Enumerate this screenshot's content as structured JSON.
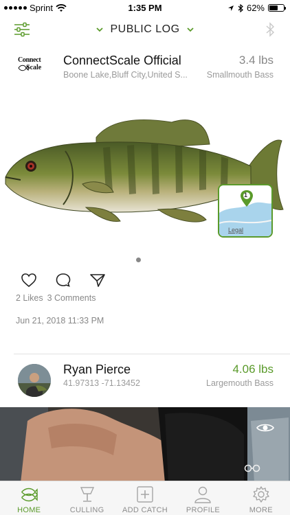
{
  "status_bar": {
    "carrier": "Sprint",
    "time": "1:35 PM",
    "battery": "62%",
    "battery_level": 0.62
  },
  "header": {
    "title": "PUBLIC LOG",
    "filter_icon": "sliders-icon",
    "bluetooth_icon": "bluetooth-icon"
  },
  "posts": [
    {
      "user": "ConnectScale Official",
      "logo_line1": "Connect",
      "logo_line2": "Scale",
      "location": "Boone Lake,Bluff City,United S...",
      "weight": "3.4 lbs",
      "species": "Smallmouth Bass",
      "map_pin": "1",
      "map_legal": "Legal",
      "likes": "2 Likes",
      "comments": "3 Comments",
      "date": "Jun 21, 2018 11:33 PM"
    },
    {
      "user": "Ryan Pierce",
      "coords": "41.97313 -71.13452",
      "weight": "4.06 lbs",
      "species": "Largemouth Bass"
    }
  ],
  "tabs": [
    {
      "label": "HOME",
      "icon": "fish-icon",
      "active": true
    },
    {
      "label": "CULLING",
      "icon": "scale-icon",
      "active": false
    },
    {
      "label": "ADD CATCH",
      "icon": "add-icon",
      "active": false
    },
    {
      "label": "PROFILE",
      "icon": "person-icon",
      "active": false
    },
    {
      "label": "MORE",
      "icon": "gear-icon",
      "active": false
    }
  ],
  "colors": {
    "accent": "#5a9a2a",
    "muted_text": "#9a9a9a"
  }
}
